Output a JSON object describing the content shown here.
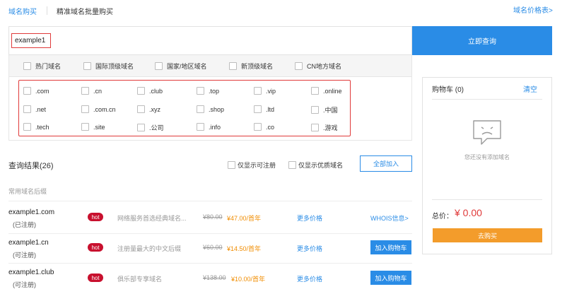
{
  "tabs": {
    "buy": "域名购买",
    "bulk": "精准域名批量购买",
    "price_table": "域名价格表>"
  },
  "search": {
    "query": "example1",
    "button": "立即查询"
  },
  "categories": [
    "热门域名",
    "国际顶级域名",
    "国家/地区域名",
    "新顶级域名",
    "CN地方域名"
  ],
  "tlds": [
    [
      ".com",
      ".cn",
      ".club",
      ".top",
      ".vip",
      ".online"
    ],
    [
      ".net",
      ".com.cn",
      ".xyz",
      ".shop",
      ".ltd",
      ".中国"
    ],
    [
      ".tech",
      ".site",
      ".公司",
      ".info",
      ".co",
      ".游戏"
    ]
  ],
  "results": {
    "title": "查询结果(26)",
    "filter_available": "仅显示可注册",
    "filter_premium": "仅显示优质域名",
    "add_all": "全部加入",
    "common_label": "常用域名后缀"
  },
  "rows": [
    {
      "domain": "example1.com",
      "status": "(已注册)",
      "badge": "hot",
      "desc": "网络服务首选经典域名...",
      "old_price": "¥80.00",
      "new_price": "¥47.00/首年",
      "more": "更多价格",
      "action": "WHOIS信息>"
    },
    {
      "domain": "example1.cn",
      "status": "(可注册)",
      "badge": "hot",
      "desc": "注册量最大的中文后缀",
      "old_price": "¥60.00",
      "new_price": "¥14.50/首年",
      "more": "更多价格",
      "action": "加入购物车"
    },
    {
      "domain": "example1.club",
      "status": "(可注册)",
      "badge": "hot",
      "desc": "俱乐部专享域名",
      "old_price": "¥138.00",
      "new_price": "¥10.00/首年",
      "more": "更多价格",
      "action": "加入购物车"
    }
  ],
  "cart": {
    "title": "购物车",
    "count": "(0)",
    "clear": "清空",
    "empty": "您还没有添加域名",
    "total_label": "总价：",
    "total_value": "¥ 0.00",
    "buy": "去购买"
  },
  "colors": {
    "accent": "#2a8ce6",
    "highlight_border": "#e03a3a",
    "hot_badge": "#c8102e",
    "price": "#f08c00",
    "buy_button": "#f39c2b"
  }
}
